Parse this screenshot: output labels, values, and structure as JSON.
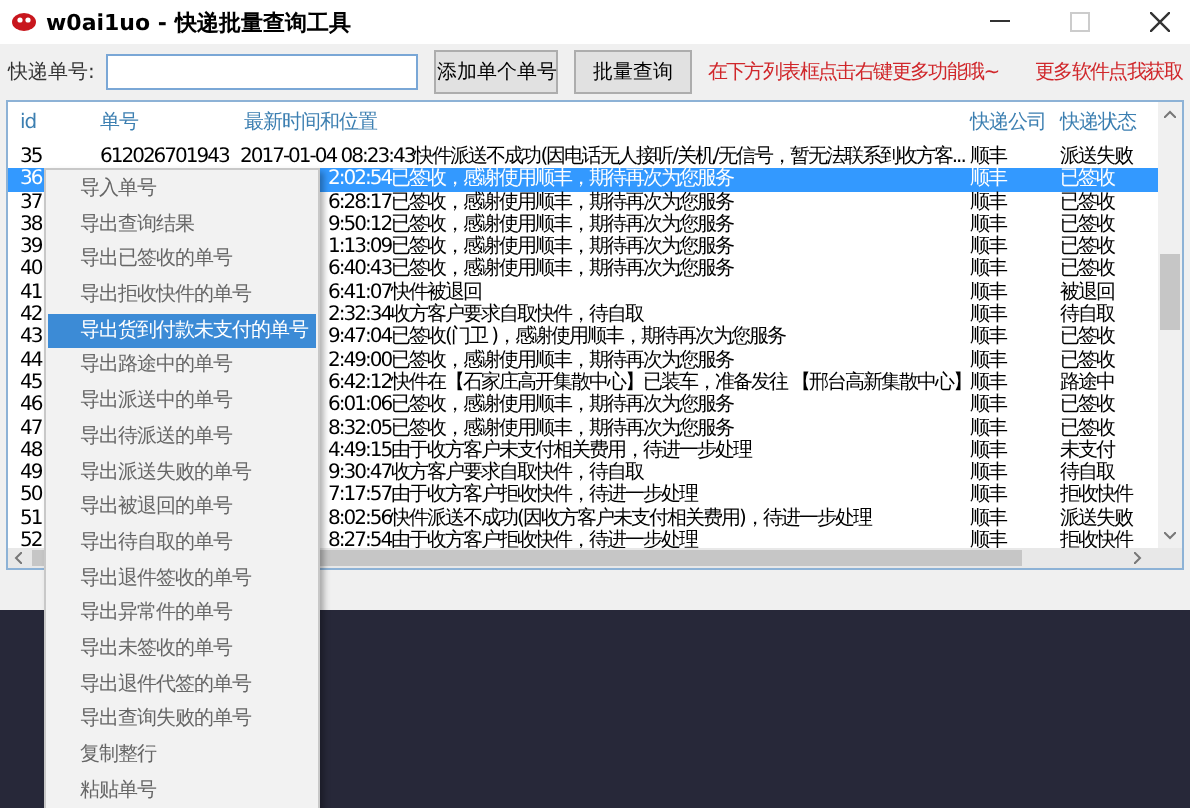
{
  "window": {
    "title": "w0ai1uo - 快递批量查询工具"
  },
  "toolbar": {
    "field_label": "快递单号:",
    "buttons": [
      "添加单个单号",
      "批量查询"
    ],
    "hint": "在下方列表框点击右键更多功能哦~",
    "link": "更多软件点我获取"
  },
  "table": {
    "columns": [
      "id",
      "单号",
      "最新时间和位置",
      "快递公司",
      "快递状态"
    ],
    "rows": [
      {
        "id": "35",
        "number": "612026701943",
        "location": "2017-01-04 08:23:43快件派送不成功(因电话无人接听/关机/无信号，暂无法联系到收方客...",
        "company": "顺丰",
        "status": "派送失败",
        "selected": false
      },
      {
        "id": "36",
        "location": "2:02:54已签收，感谢使用顺丰，期待再次为您服务",
        "company": "顺丰",
        "status": "已签收",
        "selected": true
      },
      {
        "id": "37",
        "location": "6:28:17已签收，感谢使用顺丰，期待再次为您服务",
        "company": "顺丰",
        "status": "已签收",
        "selected": false
      },
      {
        "id": "38",
        "location": "9:50:12已签收，感谢使用顺丰，期待再次为您服务",
        "company": "顺丰",
        "status": "已签收",
        "selected": false
      },
      {
        "id": "39",
        "location": "1:13:09已签收，感谢使用顺丰，期待再次为您服务",
        "company": "顺丰",
        "status": "已签收",
        "selected": false
      },
      {
        "id": "40",
        "location": "6:40:43已签收，感谢使用顺丰，期待再次为您服务",
        "company": "顺丰",
        "status": "已签收",
        "selected": false
      },
      {
        "id": "41",
        "location": "6:41:07快件被退回",
        "company": "顺丰",
        "status": "被退回",
        "selected": false
      },
      {
        "id": "42",
        "location": "2:32:34收方客户要求自取快件，待自取",
        "company": "顺丰",
        "status": "待自取",
        "selected": false
      },
      {
        "id": "43",
        "location": "9:47:04已签收(门卫 )，感谢使用顺丰，期待再次为您服务",
        "company": "顺丰",
        "status": "已签收",
        "selected": false
      },
      {
        "id": "44",
        "location": "2:49:00已签收，感谢使用顺丰，期待再次为您服务",
        "company": "顺丰",
        "status": "已签收",
        "selected": false
      },
      {
        "id": "45",
        "location": "6:42:12快件在【石家庄高开集散中心】已装车，准备发往 【邢台高新集散中心】",
        "company": "顺丰",
        "status": "路途中",
        "selected": false
      },
      {
        "id": "46",
        "location": "6:01:06已签收，感谢使用顺丰，期待再次为您服务",
        "company": "顺丰",
        "status": "已签收",
        "selected": false
      },
      {
        "id": "47",
        "location": "8:32:05已签收，感谢使用顺丰，期待再次为您服务",
        "company": "顺丰",
        "status": "已签收",
        "selected": false
      },
      {
        "id": "48",
        "location": "4:49:15由于收方客户未支付相关费用，待进一步处理",
        "company": "顺丰",
        "status": "未支付",
        "selected": false
      },
      {
        "id": "49",
        "location": "9:30:47收方客户要求自取快件，待自取",
        "company": "顺丰",
        "status": "待自取",
        "selected": false
      },
      {
        "id": "50",
        "location": "7:17:57由于收方客户拒收快件，待进一步处理",
        "company": "顺丰",
        "status": "拒收快件",
        "selected": false
      },
      {
        "id": "51",
        "location": "8:02:56快件派送不成功(因收方客户未支付相关费用)，待进一步处理",
        "company": "顺丰",
        "status": "派送失败",
        "selected": false
      },
      {
        "id": "52",
        "location": "8:27:54由于收方客户拒收快件，待进一步处理",
        "company": "顺丰",
        "status": "拒收快件",
        "selected": false
      }
    ]
  },
  "context_menu": {
    "items": [
      {
        "label": "导入单号",
        "selected": false
      },
      {
        "label": "导出查询结果",
        "selected": false
      },
      {
        "label": "导出已签收的单号",
        "selected": false
      },
      {
        "label": "导出拒收快件的单号",
        "selected": false
      },
      {
        "label": "导出货到付款未支付的单号",
        "selected": true
      },
      {
        "label": "导出路途中的单号",
        "selected": false
      },
      {
        "label": "导出派送中的单号",
        "selected": false
      },
      {
        "label": "导出待派送的单号",
        "selected": false
      },
      {
        "label": "导出派送失败的单号",
        "selected": false
      },
      {
        "label": "导出被退回的单号",
        "selected": false
      },
      {
        "label": "导出待自取的单号",
        "selected": false
      },
      {
        "label": "导出退件签收的单号",
        "selected": false
      },
      {
        "label": "导出异常件的单号",
        "selected": false
      },
      {
        "label": "导出未签收的单号",
        "selected": false
      },
      {
        "label": "导出退件代签的单号",
        "selected": false
      },
      {
        "label": "导出查询失败的单号",
        "selected": false
      },
      {
        "label": "复制整行",
        "selected": false
      },
      {
        "label": "粘贴单号",
        "selected": false
      }
    ]
  }
}
